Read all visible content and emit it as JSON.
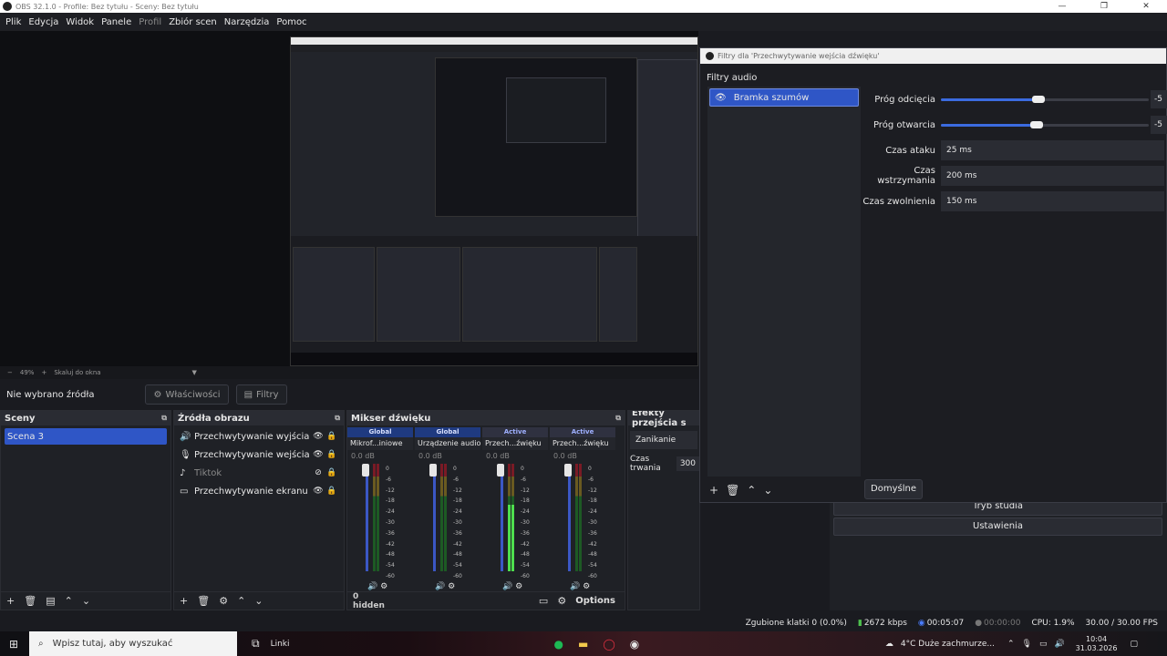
{
  "window": {
    "title": "OBS 32.1.0 - Profile: Bez tytułu - Sceny: Bez tytułu",
    "controls": [
      "—",
      "❐",
      "✕"
    ]
  },
  "menu": [
    "Plik",
    "Edycja",
    "Widok",
    "Panele",
    "Profil",
    "Zbiór scen",
    "Narzędzia",
    "Pomoc"
  ],
  "zoom": {
    "percent": "49%",
    "mode": "Skaluj do okna"
  },
  "source_toolbar": {
    "no_source": "Nie wybrano źródła",
    "properties": "Właściwości",
    "filters": "Filtry"
  },
  "scenes": {
    "title": "Sceny",
    "items": [
      "Scena 3"
    ]
  },
  "sources": {
    "title": "Źródła obrazu",
    "items": [
      {
        "name": "Przechwytywanie wyjścia dźwięku",
        "icon": "speaker-icon"
      },
      {
        "name": "Przechwytywanie wejścia dźwięku",
        "icon": "mic-icon"
      },
      {
        "name": "Tiktok",
        "icon": "tiktok-icon"
      },
      {
        "name": "Przechwytywanie ekranu",
        "icon": "monitor-icon"
      }
    ]
  },
  "mixer": {
    "title": "Mikser dźwięku",
    "channels": [
      {
        "scope": "Global",
        "name": "Mikrof...iniowe",
        "db": "0.0 dB",
        "level": 0
      },
      {
        "scope": "Global",
        "name": "Urządzenie audio",
        "db": "0.0 dB",
        "level": 0
      },
      {
        "scope": "Active",
        "name": "Przech...źwięku",
        "db": "0.0 dB",
        "level": 0.62
      },
      {
        "scope": "Active",
        "name": "Przech...źwięku",
        "db": "0.0 dB",
        "level": 0
      }
    ],
    "scale": [
      "0",
      "-6",
      "-12",
      "-18",
      "-24",
      "-30",
      "-36",
      "-42",
      "-48",
      "-54",
      "-60"
    ],
    "hidden_count": "0 hidden",
    "options": "Options"
  },
  "transitions": {
    "title": "Efekty przejścia s",
    "effect": "Zanikanie",
    "duration_label": "Czas trwania",
    "duration_value": "300"
  },
  "filter_dialog": {
    "title": "Filtry dla 'Przechwytywanie wejścia dźwięku'",
    "section": "Filtry audio",
    "filters": [
      "Bramka szumów"
    ],
    "params": {
      "close_threshold": {
        "label": "Próg odcięcia",
        "value": "-5",
        "fraction": 0.47
      },
      "open_threshold": {
        "label": "Próg otwarcia",
        "value": "-5",
        "fraction": 0.46
      },
      "attack": {
        "label": "Czas ataku",
        "value": "25 ms"
      },
      "hold": {
        "label": "Czas wstrzymania",
        "value": "200 ms"
      },
      "release": {
        "label": "Czas zwolnienia",
        "value": "150 ms"
      }
    },
    "defaults_button": "Domyślne"
  },
  "controls": {
    "exit_studio": "Tryb studia",
    "settings": "Ustawienia"
  },
  "status": {
    "dropped": "Zgubione klatki 0 (0.0%)",
    "bitrate": "2672 kbps",
    "stream_time": "00:05:07",
    "rec_time": "00:00:00",
    "cpu": "CPU: 1.9%",
    "fps": "30.00 / 30.00 FPS"
  },
  "taskbar": {
    "search": "Wpisz tutaj, aby wyszukać",
    "links": "Linki",
    "weather": "4°C  Duże zachmurze...",
    "time": "10:04",
    "date": "31.03.2026"
  }
}
